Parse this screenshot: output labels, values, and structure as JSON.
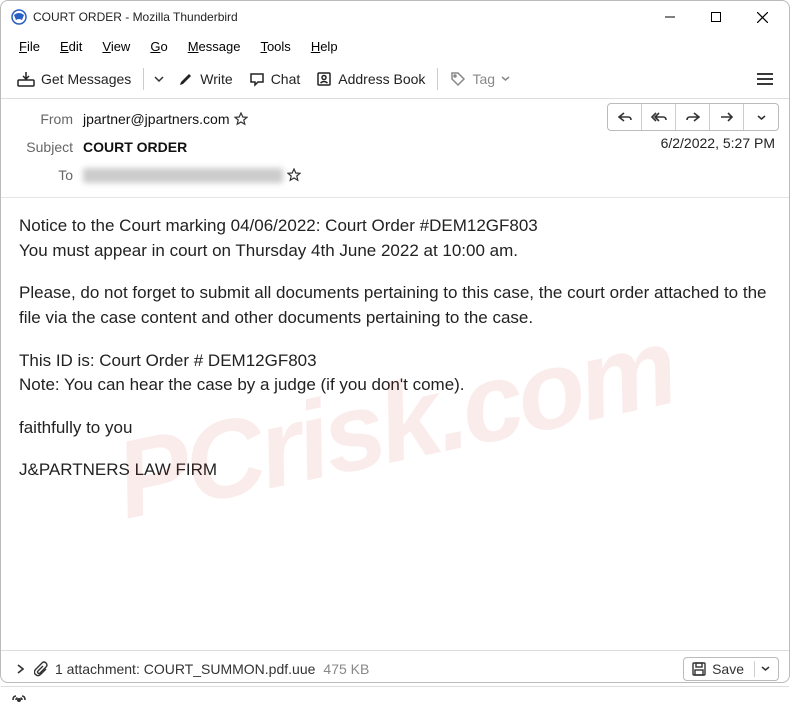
{
  "window": {
    "title": "COURT ORDER - Mozilla Thunderbird"
  },
  "menu": {
    "file": "File",
    "edit": "Edit",
    "view": "View",
    "go": "Go",
    "message": "Message",
    "tools": "Tools",
    "help": "Help"
  },
  "toolbar": {
    "get_messages": "Get Messages",
    "write": "Write",
    "chat": "Chat",
    "address_book": "Address Book",
    "tag": "Tag"
  },
  "header": {
    "from_label": "From",
    "from_value": "jpartner@jpartners.com",
    "subject_label": "Subject",
    "subject_value": "COURT ORDER",
    "to_label": "To",
    "to_value_redacted": true,
    "datetime": "6/2/2022, 5:27 PM"
  },
  "body": {
    "line1": "Notice to the Court marking 04/06/2022: Court Order #DEM12GF803",
    "line2": "You must appear in court on Thursday 4th June 2022 at 10:00 am.",
    "para2": "Please, do not forget to submit all documents pertaining to this case, the court order attached to the file via the case content and other documents pertaining to the case.",
    "line3": "This ID is: Court Order # DEM12GF803",
    "line4": "Note: You can hear the case by a judge (if you don't come).",
    "line5": "faithfully to you",
    "line6": "J&PARTNERS LAW FIRM"
  },
  "attachment": {
    "summary": "1 attachment: COURT_SUMMON.pdf.uue",
    "size": "475 KB",
    "save_label": "Save"
  },
  "watermark": "PCrisk.com"
}
